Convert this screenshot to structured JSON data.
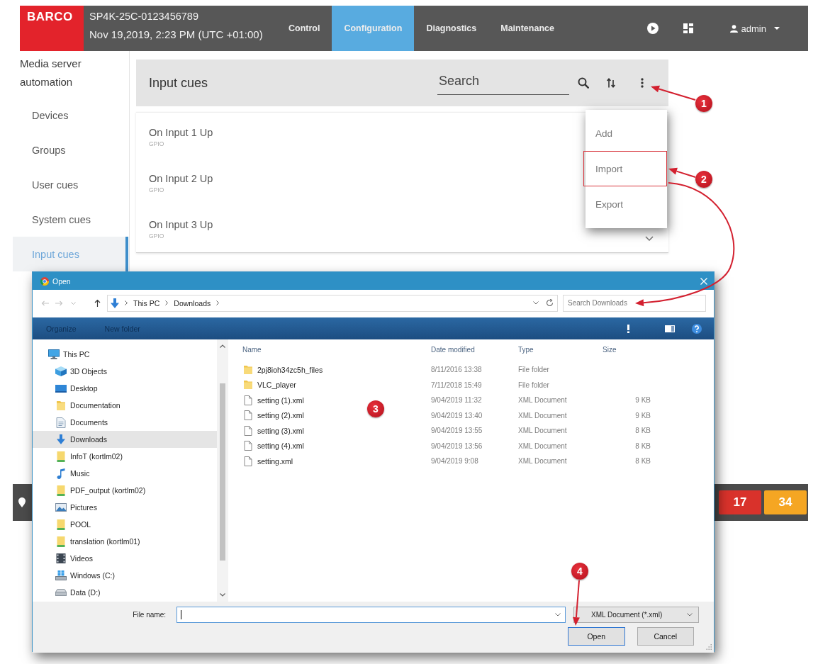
{
  "header": {
    "logo": "BARCO",
    "device": "SP4K-25C-0123456789",
    "datetime": "Nov 19,2019, 2:23 PM (UTC +01:00)",
    "tabs": [
      {
        "label": "Control",
        "selected": false
      },
      {
        "label": "Configuration",
        "selected": true
      },
      {
        "label": "Diagnostics",
        "selected": false
      },
      {
        "label": "Maintenance",
        "selected": false
      }
    ],
    "user": "admin"
  },
  "sidebar": {
    "title": "Media server automation",
    "items": [
      {
        "label": "Devices",
        "selected": false
      },
      {
        "label": "Groups",
        "selected": false
      },
      {
        "label": "User cues",
        "selected": false
      },
      {
        "label": "System cues",
        "selected": false
      },
      {
        "label": "Input cues",
        "selected": true
      }
    ]
  },
  "panel": {
    "title": "Input cues",
    "search": {
      "placeholder": "Search"
    },
    "rows": [
      {
        "name": "On Input 1 Up",
        "type": "GPIO"
      },
      {
        "name": "On Input 2 Up",
        "type": "GPIO"
      },
      {
        "name": "On Input 3 Up",
        "type": "GPIO"
      }
    ]
  },
  "menu": {
    "items": [
      {
        "label": "Add",
        "outlined": false
      },
      {
        "label": "Import",
        "outlined": true
      },
      {
        "label": "Export",
        "outlined": false
      }
    ]
  },
  "status_bar": {
    "badges": [
      {
        "count": "17",
        "color": "#d9322b"
      },
      {
        "count": "34",
        "color": "#f5a623"
      }
    ]
  },
  "dialog": {
    "title": "Open",
    "path": [
      "This PC",
      "Downloads"
    ],
    "search": {
      "placeholder": "Search Downloads"
    },
    "toolbar": [
      "Organize",
      "New folder"
    ],
    "nav": [
      {
        "label": "This PC",
        "kind": "computer",
        "selected": false,
        "children": [
          {
            "label": "3D Objects",
            "kind": "objects",
            "selected": false
          },
          {
            "label": "Desktop",
            "kind": "desktop",
            "selected": false
          },
          {
            "label": "Documentation",
            "kind": "folder",
            "selected": false
          },
          {
            "label": "Documents",
            "kind": "documents",
            "selected": false
          },
          {
            "label": "Downloads",
            "kind": "downloads",
            "selected": true
          },
          {
            "label": "InfoT (kortlm02)",
            "kind": "network",
            "selected": false
          },
          {
            "label": "Music",
            "kind": "music",
            "selected": false
          },
          {
            "label": "PDF_output (kortlm02)",
            "kind": "network",
            "selected": false
          },
          {
            "label": "Pictures",
            "kind": "pictures",
            "selected": false
          },
          {
            "label": "POOL",
            "kind": "network",
            "selected": false
          },
          {
            "label": "translation (kortlm01)",
            "kind": "network",
            "selected": false
          },
          {
            "label": "Videos",
            "kind": "videos",
            "selected": false
          },
          {
            "label": "Windows (C:)",
            "kind": "systemdrive",
            "selected": false
          },
          {
            "label": "Data (D:)",
            "kind": "drive",
            "selected": false
          }
        ]
      }
    ],
    "columns": [
      "Name",
      "Date modified",
      "Type",
      "Size"
    ],
    "files": [
      {
        "kind": "folder",
        "name": "2pj8ioh34zc5h_files",
        "date": "8/11/2016 13:38",
        "type": "File folder"
      },
      {
        "kind": "folder",
        "name": "VLC_player",
        "date": "7/11/2018 15:49",
        "type": "File folder"
      },
      {
        "kind": "file",
        "name": "setting (1).xml",
        "date": "9/04/2019 11:32",
        "type": "XML Document",
        "size": "9 KB"
      },
      {
        "kind": "file",
        "name": "setting (2).xml",
        "date": "9/04/2019 13:40",
        "type": "XML Document",
        "size": "9 KB"
      },
      {
        "kind": "file",
        "name": "setting (3).xml",
        "date": "9/04/2019 13:55",
        "type": "XML Document",
        "size": "8 KB"
      },
      {
        "kind": "file",
        "name": "setting (4).xml",
        "date": "9/04/2019 13:56",
        "type": "XML Document",
        "size": "8 KB"
      },
      {
        "kind": "file",
        "name": "setting.xml",
        "date": "9/04/2019 9:08",
        "type": "XML Document",
        "size": "8 KB"
      }
    ],
    "file_name": {
      "label": "File name:",
      "focused": true
    },
    "filter": "XML Document (*.xml)",
    "buttons": [
      {
        "label": "Open",
        "default": true
      },
      {
        "label": "Cancel",
        "default": false
      }
    ]
  },
  "callouts": [
    {
      "number": "1"
    },
    {
      "number": "2"
    },
    {
      "number": "3"
    },
    {
      "number": "4"
    }
  ]
}
